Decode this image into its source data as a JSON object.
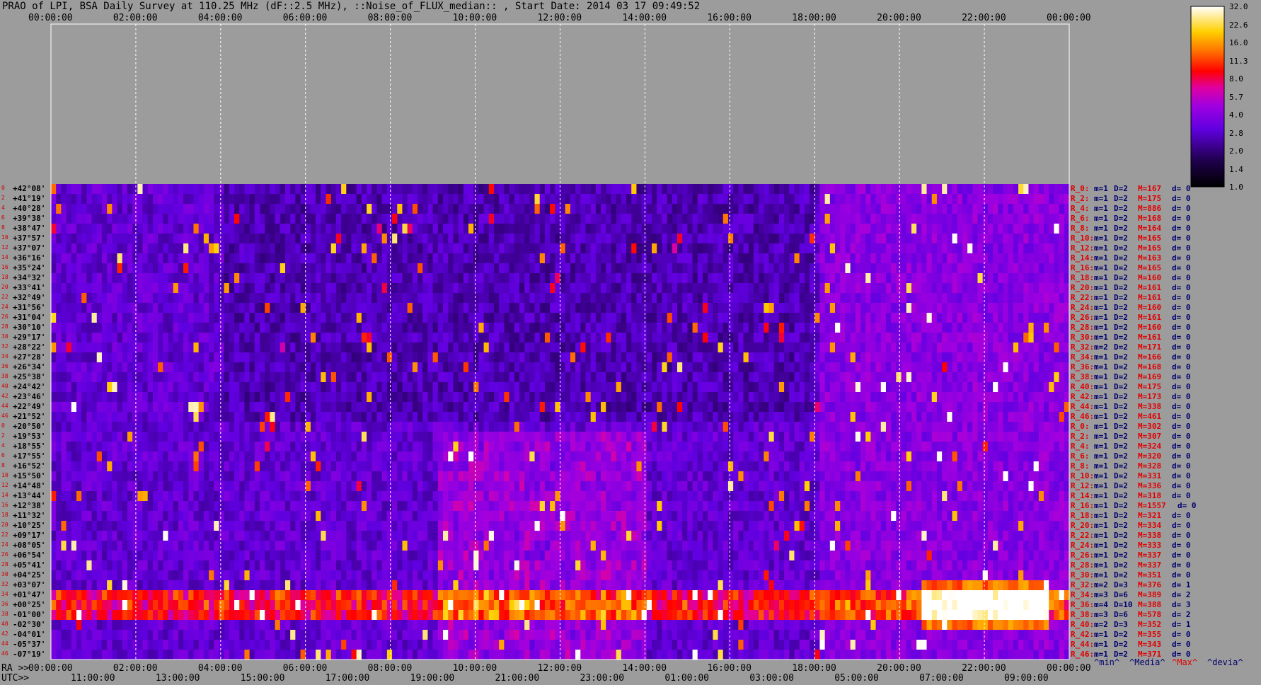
{
  "title": "PRAO of LPI, BSA Daily Survey at 110.25 MHz (dF::2.5 MHz), ::Noise_of_FLUX_median:: , Start Date: 2014 03 17 09:49:52",
  "colors": {
    "background": "#9c9c9c",
    "gridline": "#ffffff",
    "label_red": "#e00000",
    "label_blue": "#00006e"
  },
  "axes": {
    "top_ticks": [
      "00:00:00",
      "02:00:00",
      "04:00:00",
      "06:00:00",
      "08:00:00",
      "10:00:00",
      "12:00:00",
      "14:00:00",
      "16:00:00",
      "18:00:00",
      "20:00:00",
      "22:00:00",
      "00:00:00"
    ],
    "ra_prefix": "RA >>",
    "ra_ticks": [
      "00:00:00",
      "02:00:00",
      "04:00:00",
      "06:00:00",
      "08:00:00",
      "10:00:00",
      "12:00:00",
      "14:00:00",
      "16:00:00",
      "18:00:00",
      "20:00:00",
      "22:00:00",
      "00:00:00"
    ],
    "utc_prefix": "UTC>>",
    "utc_ticks": [
      "11:00:00",
      "13:00:00",
      "15:00:00",
      "17:00:00",
      "19:00:00",
      "21:00:00",
      "23:00:00",
      "01:00:00",
      "03:00:00",
      "05:00:00",
      "07:00:00",
      "09:00:00"
    ]
  },
  "colorbar": {
    "labels": [
      "32.0",
      "22.6",
      "16.0",
      "11.3",
      "8.0",
      "5.7",
      "4.0",
      "2.8",
      "2.0",
      "1.4",
      "1.0"
    ]
  },
  "legend": {
    "min": "^min^",
    "media": "^Media^",
    "max": "^Max^",
    "devia": "^devia^"
  },
  "chart_data": {
    "type": "heatmap",
    "title": "PRAO of LPI, BSA Daily Survey at 110.25 MHz (dF::2.5 MHz), ::Noise_of_FLUX_median:: , Start Date: 2014 03 17 09:49:52",
    "x_range_hours": [
      0,
      24
    ],
    "colorbar_range": [
      1.0,
      32.0
    ],
    "colorbar_scale": "log",
    "declinations": [
      "+42°08'",
      "+41°19'",
      "+40°28'",
      "+39°38'",
      "+38°47'",
      "+37°57'",
      "+37°07'",
      "+36°16'",
      "+35°24'",
      "+34°32'",
      "+33°41'",
      "+32°49'",
      "+31°56'",
      "+31°04'",
      "+30°10'",
      "+29°17'",
      "+28°22'",
      "+27°28'",
      "+26°34'",
      "+25°38'",
      "+24°42'",
      "+23°46'",
      "+22°49'",
      "+21°52'",
      "+20°50'",
      "+19°53'",
      "+18°55'",
      "+17°55'",
      "+16°52'",
      "+15°50'",
      "+14°48'",
      "+13°44'",
      "+12°38'",
      "+11°32'",
      "+10°25'",
      "+09°17'",
      "+08°05'",
      "+06°54'",
      "+05°41'",
      "+04°25'",
      "+03°07'",
      "+01°47'",
      "+00°25'",
      "-01°00'",
      "-02°30'",
      "-04°01'",
      "-05°37'",
      "-07°19'"
    ],
    "row_stats": [
      {
        "r": "R_0:",
        "m": "m=1",
        "D": "D=2",
        "M": "M=167",
        "d": "d= 0"
      },
      {
        "r": "R_2:",
        "m": "m=1",
        "D": "D=2",
        "M": "M=175",
        "d": "d= 0"
      },
      {
        "r": "R_4:",
        "m": "m=1",
        "D": "D=2",
        "M": "M=886",
        "d": "d= 0"
      },
      {
        "r": "R_6:",
        "m": "m=1",
        "D": "D=2",
        "M": "M=168",
        "d": "d= 0"
      },
      {
        "r": "R_8:",
        "m": "m=1",
        "D": "D=2",
        "M": "M=164",
        "d": "d= 0"
      },
      {
        "r": "R_10:",
        "m": "m=1",
        "D": "D=2",
        "M": "M=165",
        "d": "d= 0"
      },
      {
        "r": "R_12:",
        "m": "m=1",
        "D": "D=2",
        "M": "M=165",
        "d": "d= 0"
      },
      {
        "r": "R_14:",
        "m": "m=1",
        "D": "D=2",
        "M": "M=163",
        "d": "d= 0"
      },
      {
        "r": "R_16:",
        "m": "m=1",
        "D": "D=2",
        "M": "M=165",
        "d": "d= 0"
      },
      {
        "r": "R_18:",
        "m": "m=1",
        "D": "D=2",
        "M": "M=160",
        "d": "d= 0"
      },
      {
        "r": "R_20:",
        "m": "m=1",
        "D": "D=2",
        "M": "M=161",
        "d": "d= 0"
      },
      {
        "r": "R_22:",
        "m": "m=1",
        "D": "D=2",
        "M": "M=161",
        "d": "d= 0"
      },
      {
        "r": "R_24:",
        "m": "m=1",
        "D": "D=2",
        "M": "M=160",
        "d": "d= 0"
      },
      {
        "r": "R_26:",
        "m": "m=1",
        "D": "D=2",
        "M": "M=161",
        "d": "d= 0"
      },
      {
        "r": "R_28:",
        "m": "m=1",
        "D": "D=2",
        "M": "M=160",
        "d": "d= 0"
      },
      {
        "r": "R_30:",
        "m": "m=1",
        "D": "D=2",
        "M": "M=161",
        "d": "d= 0"
      },
      {
        "r": "R_32:",
        "m": "m=2",
        "D": "D=2",
        "M": "M=171",
        "d": "d= 0"
      },
      {
        "r": "R_34:",
        "m": "m=1",
        "D": "D=2",
        "M": "M=166",
        "d": "d= 0"
      },
      {
        "r": "R_36:",
        "m": "m=1",
        "D": "D=2",
        "M": "M=168",
        "d": "d= 0"
      },
      {
        "r": "R_38:",
        "m": "m=1",
        "D": "D=2",
        "M": "M=169",
        "d": "d= 0"
      },
      {
        "r": "R_40:",
        "m": "m=1",
        "D": "D=2",
        "M": "M=175",
        "d": "d= 0"
      },
      {
        "r": "R_42:",
        "m": "m=1",
        "D": "D=2",
        "M": "M=173",
        "d": "d= 0"
      },
      {
        "r": "R_44:",
        "m": "m=1",
        "D": "D=2",
        "M": "M=338",
        "d": "d= 0"
      },
      {
        "r": "R_46:",
        "m": "m=1",
        "D": "D=2",
        "M": "M=461",
        "d": "d= 0"
      },
      {
        "r": "R_0:",
        "m": "m=1",
        "D": "D=2",
        "M": "M=302",
        "d": "d= 0"
      },
      {
        "r": "R_2:",
        "m": "m=1",
        "D": "D=2",
        "M": "M=307",
        "d": "d= 0"
      },
      {
        "r": "R_4:",
        "m": "m=1",
        "D": "D=2",
        "M": "M=324",
        "d": "d= 0"
      },
      {
        "r": "R_6:",
        "m": "m=1",
        "D": "D=2",
        "M": "M=320",
        "d": "d= 0"
      },
      {
        "r": "R_8:",
        "m": "m=1",
        "D": "D=2",
        "M": "M=328",
        "d": "d= 0"
      },
      {
        "r": "R_10:",
        "m": "m=1",
        "D": "D=2",
        "M": "M=331",
        "d": "d= 0"
      },
      {
        "r": "R_12:",
        "m": "m=1",
        "D": "D=2",
        "M": "M=336",
        "d": "d= 0"
      },
      {
        "r": "R_14:",
        "m": "m=1",
        "D": "D=2",
        "M": "M=318",
        "d": "d= 0"
      },
      {
        "r": "R_16:",
        "m": "m=1",
        "D": "D=2",
        "M": "M=1557",
        "d": "d= 0"
      },
      {
        "r": "R_18:",
        "m": "m=1",
        "D": "D=2",
        "M": "M=321",
        "d": "d= 0"
      },
      {
        "r": "R_20:",
        "m": "m=1",
        "D": "D=2",
        "M": "M=334",
        "d": "d= 0"
      },
      {
        "r": "R_22:",
        "m": "m=1",
        "D": "D=2",
        "M": "M=338",
        "d": "d= 0"
      },
      {
        "r": "R_24:",
        "m": "m=1",
        "D": "D=2",
        "M": "M=333",
        "d": "d= 0"
      },
      {
        "r": "R_26:",
        "m": "m=1",
        "D": "D=2",
        "M": "M=337",
        "d": "d= 0"
      },
      {
        "r": "R_28:",
        "m": "m=1",
        "D": "D=2",
        "M": "M=337",
        "d": "d= 0"
      },
      {
        "r": "R_30:",
        "m": "m=1",
        "D": "D=2",
        "M": "M=351",
        "d": "d= 0"
      },
      {
        "r": "R_32:",
        "m": "m=2",
        "D": "D=3",
        "M": "M=376",
        "d": "d= 1"
      },
      {
        "r": "R_34:",
        "m": "m=3",
        "D": "D=6",
        "M": "M=389",
        "d": "d= 2"
      },
      {
        "r": "R_36:",
        "m": "m=4",
        "D": "D=10",
        "M": "M=388",
        "d": "d= 3"
      },
      {
        "r": "R_38:",
        "m": "m=3",
        "D": "D=6",
        "M": "M=578",
        "d": "d= 2"
      },
      {
        "r": "R_40:",
        "m": "m=2",
        "D": "D=3",
        "M": "M=352",
        "d": "d= 1"
      },
      {
        "r": "R_42:",
        "m": "m=1",
        "D": "D=2",
        "M": "M=355",
        "d": "d= 0"
      },
      {
        "r": "R_44:",
        "m": "m=1",
        "D": "D=2",
        "M": "M=343",
        "d": "d= 0"
      },
      {
        "r": "R_46:",
        "m": "m=1",
        "D": "D=2",
        "M": "M=371",
        "d": "d= 0"
      }
    ],
    "row_index_labels": [
      "0",
      "2",
      "4",
      "6",
      "8",
      "10",
      "12",
      "14",
      "16",
      "18",
      "20",
      "22",
      "24",
      "26",
      "28",
      "30",
      "32",
      "34",
      "36",
      "38",
      "40",
      "42",
      "44",
      "46",
      "0",
      "2",
      "4",
      "6",
      "8",
      "10",
      "12",
      "14",
      "16",
      "18",
      "20",
      "22",
      "24",
      "26",
      "28",
      "30",
      "32",
      "34",
      "36",
      "38",
      "40",
      "42",
      "44",
      "46"
    ]
  }
}
